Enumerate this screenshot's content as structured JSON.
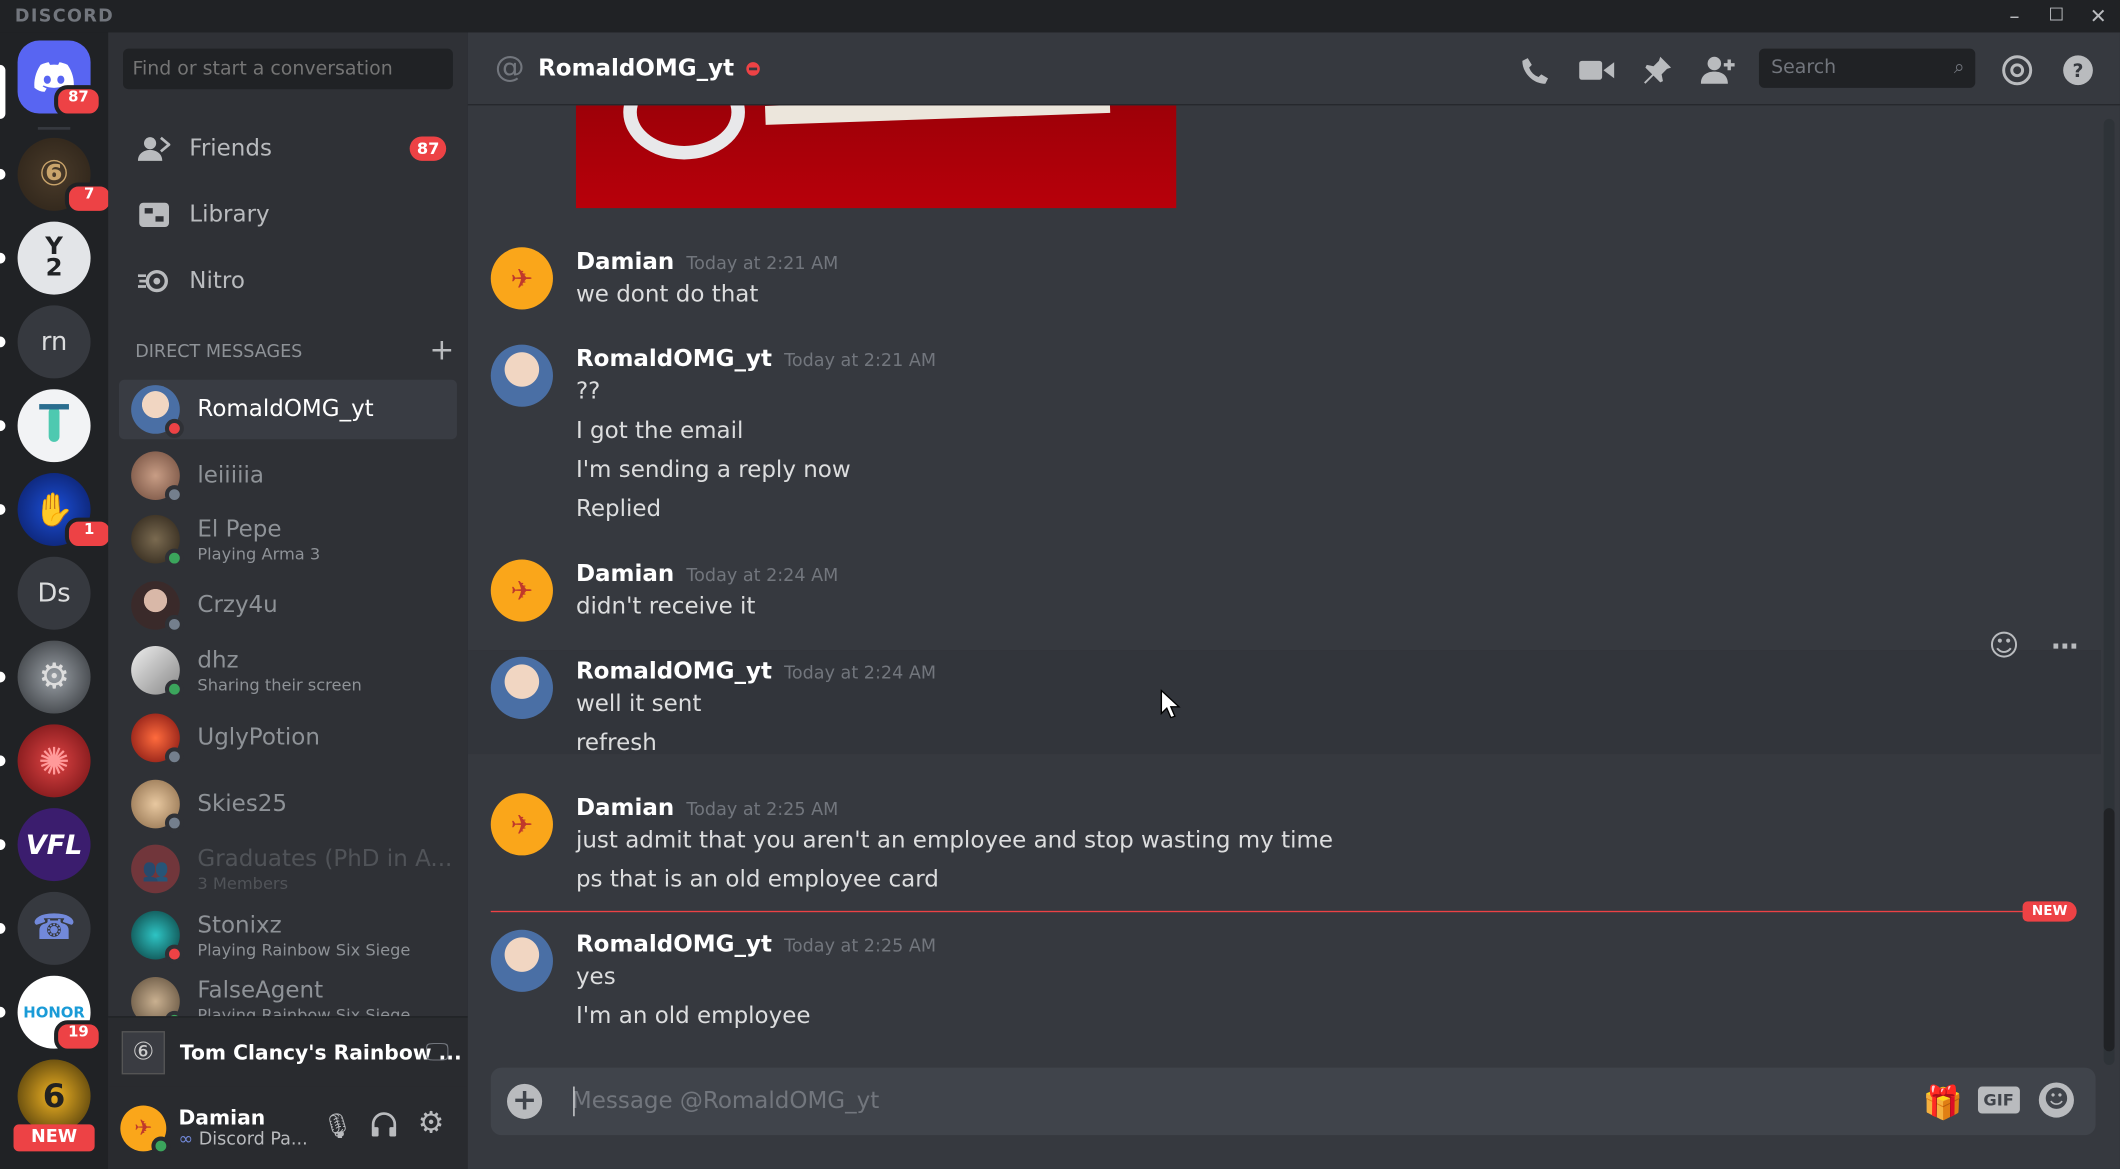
{
  "titlebar": {
    "brand": "DISCORD",
    "minimize": "–",
    "maximize": "☐",
    "close": "✕"
  },
  "servers": {
    "home_badge": "87",
    "items": [
      {
        "name": "rainbow-six-server",
        "badge": "7"
      },
      {
        "name": "server-2",
        "initials": "2"
      },
      {
        "name": "server-rn",
        "initials": "rn"
      },
      {
        "name": "server-lab"
      },
      {
        "name": "server-hand",
        "badge": "1"
      },
      {
        "name": "server-ds",
        "initials": "Ds"
      },
      {
        "name": "server-gear"
      },
      {
        "name": "server-virus"
      },
      {
        "name": "server-vfl",
        "initials": "VFL"
      },
      {
        "name": "server-phone"
      },
      {
        "name": "server-honor",
        "initials": "HONOR",
        "badge": "19"
      },
      {
        "name": "server-r6",
        "initials": "6"
      }
    ],
    "new_tag": "NEW"
  },
  "sidebar": {
    "search_placeholder": "Find or start a conversation",
    "nav": [
      {
        "label": "Friends",
        "badge": "87"
      },
      {
        "label": "Library"
      },
      {
        "label": "Nitro"
      }
    ],
    "dm_header": "DIRECT MESSAGES",
    "dms": [
      {
        "name": "RomaldOMG_yt",
        "sub": "",
        "status": "#ed4245"
      },
      {
        "name": "leiiiiia",
        "sub": "",
        "status": "#747f8d"
      },
      {
        "name": "El Pepe",
        "sub": "Playing Arma 3",
        "status": "#3ba55c"
      },
      {
        "name": "Crzy4u",
        "sub": "",
        "status": "#747f8d"
      },
      {
        "name": "dhz",
        "sub": "Sharing their screen",
        "status": "#3ba55c"
      },
      {
        "name": "UglyPotion",
        "sub": "",
        "status": "#747f8d"
      },
      {
        "name": "Skies25",
        "sub": "",
        "status": "#747f8d"
      },
      {
        "name": "Graduates (PhD in A...",
        "sub": "3 Members",
        "status": ""
      },
      {
        "name": "Stonixz",
        "sub": "Playing Rainbow Six Siege",
        "status": "#ed4245"
      },
      {
        "name": "FalseAgent",
        "sub": "Playing Rainbow Six Siege",
        "status": "#3ba55c"
      }
    ],
    "game": {
      "title": "Tom Clancy's Rainbow ..."
    },
    "user": {
      "name": "Damian",
      "status": "Discord Pa..."
    }
  },
  "chat": {
    "channel_name": "RomaldOMG_yt",
    "search_placeholder": "Search",
    "groups": [
      {
        "author": "Damian",
        "time": "Today at 2:21 AM",
        "lines": [
          "we dont do that"
        ]
      },
      {
        "author": "RomaldOMG_yt",
        "time": "Today at 2:21 AM",
        "lines": [
          "??",
          "I got the email",
          "I'm sending a reply now",
          "Replied"
        ]
      },
      {
        "author": "Damian",
        "time": "Today at 2:24 AM",
        "lines": [
          "didn't receive it"
        ]
      },
      {
        "author": "RomaldOMG_yt",
        "time": "Today at 2:24 AM",
        "lines": [
          "well it sent",
          "refresh"
        ]
      },
      {
        "author": "Damian",
        "time": "Today at 2:25 AM",
        "lines": [
          "just admit that you aren't an employee and stop wasting my time",
          "ps that is an old employee card"
        ]
      },
      {
        "author": "RomaldOMG_yt",
        "time": "Today at 2:25 AM",
        "lines": [
          "yes",
          "I'm an old employee"
        ]
      }
    ],
    "new_label": "NEW",
    "composer_placeholder": "Message @RomaldOMG_yt",
    "gif_label": "GIF"
  }
}
